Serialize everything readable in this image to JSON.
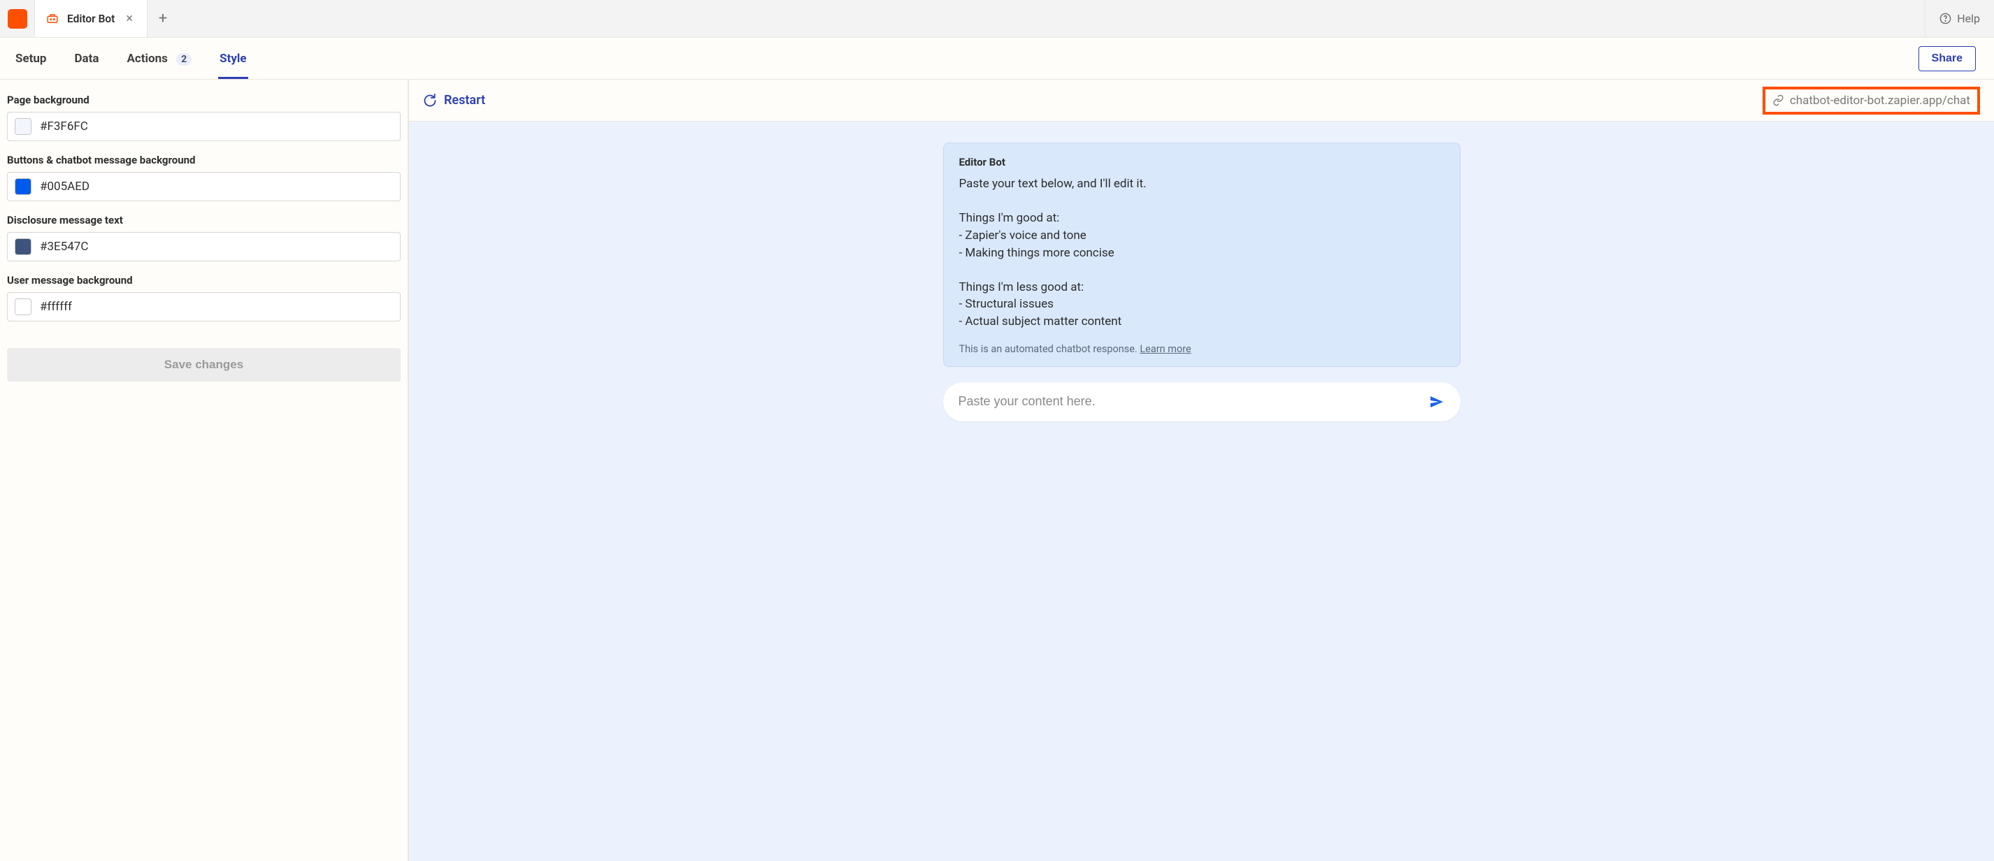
{
  "topbar": {
    "tab_title": "Editor Bot",
    "help_label": "Help"
  },
  "nav": {
    "setup": "Setup",
    "data": "Data",
    "actions": "Actions",
    "actions_count": "2",
    "style": "Style",
    "share_label": "Share"
  },
  "style_panel": {
    "page_bg_label": "Page background",
    "page_bg_value": "#F3F6FC",
    "buttons_bg_label": "Buttons & chatbot message background",
    "buttons_bg_value": "#005AED",
    "disclosure_label": "Disclosure message text",
    "disclosure_value": "#3E547C",
    "user_bg_label": "User message background",
    "user_bg_value": "#ffffff",
    "save_label": "Save changes",
    "swatch_page_bg": "#F3F6FC",
    "swatch_buttons_bg": "#005AED",
    "swatch_disclosure": "#3E547C",
    "swatch_user_bg": "#ffffff"
  },
  "preview": {
    "restart_label": "Restart",
    "url": "chatbot-editor-bot.zapier.app/chat",
    "bot_name": "Editor Bot",
    "bot_message": "Paste your text below, and I'll edit it.\n\nThings I'm good at:\n- Zapier's voice and tone\n- Making things more concise\n\nThings I'm less good at:\n- Structural issues\n- Actual subject matter content",
    "disclosure_text": "This is an automated chatbot response. ",
    "disclosure_link": "Learn more",
    "input_placeholder": "Paste your content here."
  }
}
